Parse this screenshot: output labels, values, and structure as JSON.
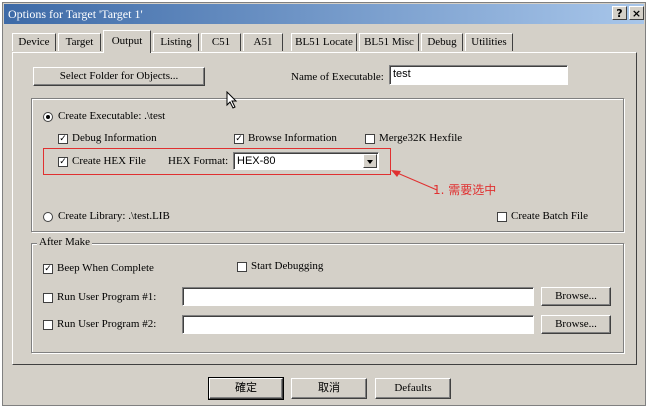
{
  "window": {
    "title": "Options for Target 'Target 1'",
    "help_label": "?",
    "close_label": "×"
  },
  "tabs": [
    {
      "label": "Device"
    },
    {
      "label": "Target"
    },
    {
      "label": "Output"
    },
    {
      "label": "Listing"
    },
    {
      "label": "C51"
    },
    {
      "label": "A51"
    },
    {
      "label": "BL51 Locate"
    },
    {
      "label": "BL51 Misc"
    },
    {
      "label": "Debug"
    },
    {
      "label": "Utilities"
    }
  ],
  "output": {
    "select_folder_label": "Select Folder for Objects...",
    "name_exec_label": "Name of Executable:",
    "name_exec_value": "test",
    "create_exec_label": "Create Executable:  .\\test",
    "debug_info_label": "Debug Information",
    "browse_info_label": "Browse Information",
    "merge_label": "Merge32K Hexfile",
    "create_hex_label": "Create HEX File",
    "hex_format_label": "HEX Format:",
    "hex_format_value": "HEX-80",
    "create_lib_label": "Create Library:  .\\test.LIB",
    "create_batch_label": "Create Batch File",
    "check_mark": "✓"
  },
  "after_make": {
    "title": "After Make",
    "beep_label": "Beep When Complete",
    "start_debug_label": "Start Debugging",
    "run1_label": "Run User Program #1:",
    "run2_label": "Run User Program #2:",
    "run1_value": "",
    "run2_value": "",
    "browse_label": "Browse..."
  },
  "annotation": {
    "text": "1. 需要选中",
    "color": "#e03030"
  },
  "footer": {
    "ok_label": "確定",
    "cancel_label": "取消",
    "defaults_label": "Defaults"
  }
}
